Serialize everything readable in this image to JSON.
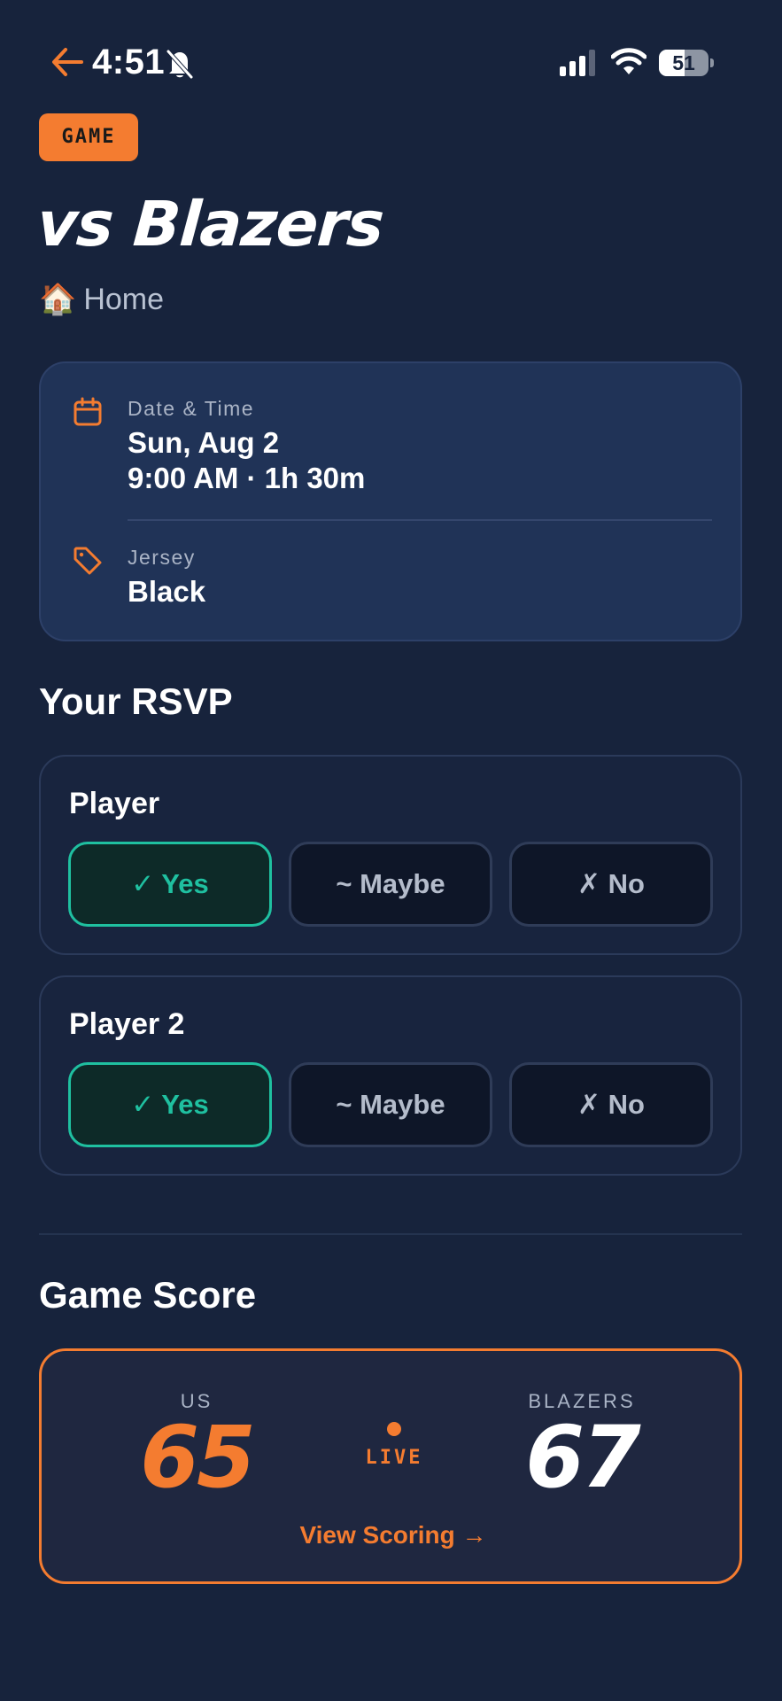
{
  "status_bar": {
    "time": "4:51",
    "battery": "51",
    "battery_level": 0.51
  },
  "header": {
    "badge": "GAME",
    "title": "vs Blazers",
    "location_icon": "🏠",
    "location": "Home"
  },
  "details": {
    "date_time": {
      "icon": "calendar-icon",
      "label": "Date & Time",
      "date": "Sun, Aug 2",
      "time": "9:00 AM · 1h 30m"
    },
    "jersey": {
      "icon": "tag-icon",
      "label": "Jersey",
      "value": "Black"
    }
  },
  "rsvp": {
    "title": "Your RSVP",
    "players": [
      {
        "name": "Player",
        "yes": "✓ Yes",
        "maybe": "~ Maybe",
        "no": "✗ No",
        "selected": "yes"
      },
      {
        "name": "Player 2",
        "yes": "✓ Yes",
        "maybe": "~ Maybe",
        "no": "✗ No",
        "selected": "yes"
      }
    ]
  },
  "score": {
    "title": "Game Score",
    "home_label": "US",
    "home_score": "65",
    "away_label": "BLAZERS",
    "away_score": "67",
    "status": "LIVE",
    "link": "View Scoring →"
  },
  "colors": {
    "background": "#17233c",
    "accent": "#f47c30",
    "selected": "#1fc0a0",
    "card": "#203357"
  }
}
